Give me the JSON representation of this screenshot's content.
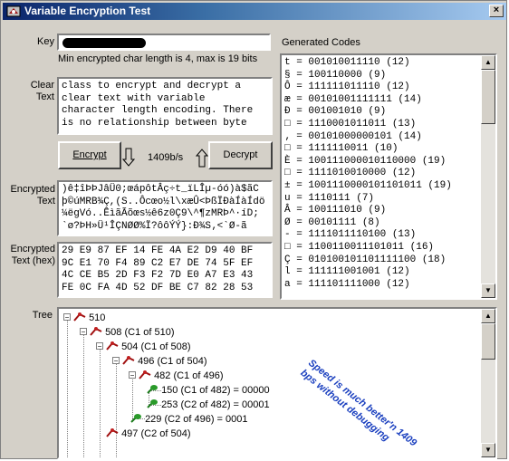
{
  "window": {
    "title": "Variable Encryption Test",
    "close_glyph": "×"
  },
  "key": {
    "label": "Key",
    "info": "Min encrypted char length is 4, max is 19 bits"
  },
  "clear": {
    "label_line1": "Clear",
    "label_line2": "Text",
    "lines": [
      "class to encrypt and decrypt a",
      "clear text with variable",
      "character length encoding. There",
      "is no relationship between byte"
    ]
  },
  "controls": {
    "encrypt_label": "Encrypt",
    "decrypt_label": "Decrypt",
    "rate": "1409b/s"
  },
  "encrypted": {
    "label_line1": "Encrypted",
    "label_line2": "Text",
    "lines": [
      ")ê‡îÞÞJâÜ0;œápôtÂç÷t_ïLÎµ-óó)à$ãC",
      "þ©úMRB¾Ç,(S..Ôcœo½l\\xæÛ<ÞßÏÐàÍàÍdö",
      "¼ëgVó..ÊìãÃõœs½ê6z0Ç9\\^¶zMRÞ^·íD;",
      "`ø?ÞH»Ü¹ÎÇNØØ%Ï?ôôÝÝ}:Ð¾S‚<`Ø-ã"
    ]
  },
  "encrypted_hex": {
    "label_line1": "Encrypted",
    "label_line2": "Text (hex)",
    "lines": [
      "29 E9 87 EF 14 FE 4A E2 D9 40 BF",
      "9C E1 70 F4 89 C2 E7 DE 74 5F EF",
      "4C CE B5 2D F3 F2 7D E0 A7 E3 43",
      "FE 0C FA 4D 52 DF BE C7 82 28 53"
    ]
  },
  "generated": {
    "label": "Generated Codes",
    "rows": [
      "t = 001010011110 (12)",
      "§ = 100110000 (9)",
      "Ô = 111111011110 (12)",
      "æ = 00101001111111 (14)",
      "Ð = 001001010 (9)",
      "□ = 1110001011011 (13)",
      "‚ = 00101000000101 (14)",
      "□ = 1111110011 (10)",
      "È = 100111000010110000 (19)",
      "□ = 1111010010000 (12)",
      "± = 1001110000101101011 (19)",
      "u = 1110111 (7)",
      "Â = 100111010 (9)",
      "Ø = 00101111 (8)",
      "- = 1111011110100 (13)",
      "□ = 1100110011101011 (16)",
      "Ç = 010100101101111100 (18)",
      "l = 111111001001 (12)",
      "a = 111101111000 (12)"
    ]
  },
  "tree": {
    "label": "Tree",
    "nodes": [
      "510",
      "508 (C1 of 510)",
      "504 (C1 of 508)",
      "496 (C1 of 504)",
      "482 (C1 of 496)",
      "150 (C1 of 482) = 00000",
      "253 (C2 of 482) = 00001",
      "229 (C2 of 496) = 0001",
      "497 (C2 of 504)"
    ],
    "toggle_minus": "−",
    "note": "Speed is much better'n 1409 bps without debugging"
  }
}
